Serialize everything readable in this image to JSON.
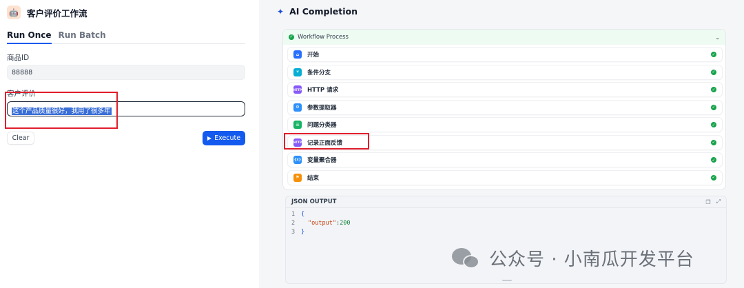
{
  "app": {
    "icon": "robot-icon",
    "title": "客户评价工作流"
  },
  "tabs": [
    {
      "label": "Run Once",
      "active": true
    },
    {
      "label": "Run Batch",
      "active": false
    }
  ],
  "form": {
    "fields": [
      {
        "label": "商品ID",
        "value": "88888"
      },
      {
        "label": "客户评价",
        "value": "这个产品质量很好，我用了很多年"
      }
    ],
    "clear_label": "Clear",
    "execute_label": "Execute"
  },
  "completion": {
    "title": "AI Completion",
    "icon": "sparkle-icon"
  },
  "workflow": {
    "title": "Workflow Process",
    "status": "succeeded",
    "nodes": [
      {
        "label": "开始",
        "icon": "home-icon",
        "color": "#2970ff",
        "glyph": "⌂"
      },
      {
        "label": "条件分支",
        "icon": "branch-icon",
        "color": "#06aed4",
        "glyph": "⑂"
      },
      {
        "label": "HTTP 请求",
        "icon": "http-icon",
        "color": "#875bf7",
        "glyph": "HTTP"
      },
      {
        "label": "参数提取器",
        "icon": "parameter-extractor-icon",
        "color": "#2e90fa",
        "glyph": "⚙"
      },
      {
        "label": "问题分类器",
        "icon": "question-classifier-icon",
        "color": "#16b364",
        "glyph": "☰"
      },
      {
        "label": "记录正面反馈",
        "icon": "http-icon",
        "color": "#875bf7",
        "glyph": "HTTP"
      },
      {
        "label": "变量聚合器",
        "icon": "variable-aggregator-icon",
        "color": "#2e90fa",
        "glyph": "{x}"
      },
      {
        "label": "结束",
        "icon": "end-icon",
        "color": "#f79009",
        "glyph": "⚑"
      }
    ]
  },
  "json_output": {
    "title": "JSON OUTPUT",
    "lines": [
      {
        "n": "1",
        "text": "{"
      },
      {
        "n": "2",
        "key": "\"output\"",
        "value": "200"
      },
      {
        "n": "3",
        "text": "}"
      }
    ]
  },
  "watermark": {
    "text": "公众号 · 小南瓜开发平台",
    "icon": "wechat-icon"
  },
  "colors": {
    "primary": "#155aef",
    "success": "#16a34a",
    "highlight_box": "#e11d2c"
  }
}
